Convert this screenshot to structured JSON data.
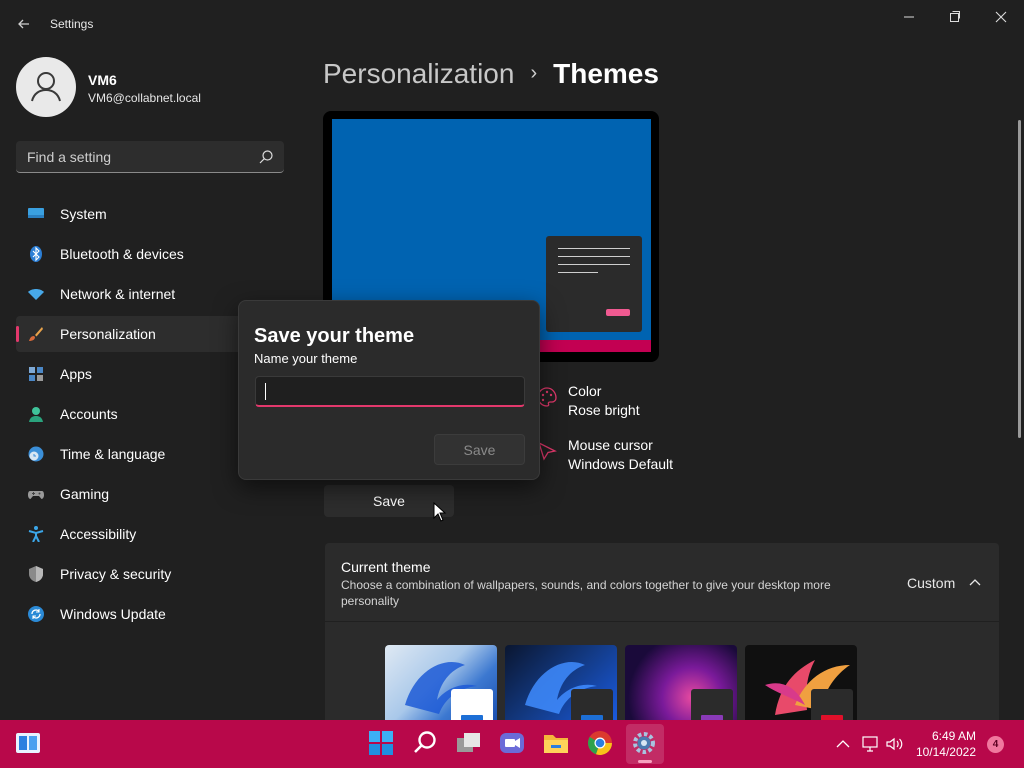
{
  "window": {
    "title": "Settings",
    "back_icon": "back-arrow-icon",
    "controls": [
      "minimize-icon",
      "restore-icon",
      "close-icon"
    ]
  },
  "user": {
    "name": "VM6",
    "email": "VM6@collabnet.local"
  },
  "search": {
    "placeholder": "Find a setting",
    "icon": "search-icon"
  },
  "nav": {
    "items": [
      {
        "label": "System",
        "icon": "system-icon"
      },
      {
        "label": "Bluetooth & devices",
        "icon": "bluetooth-icon"
      },
      {
        "label": "Network & internet",
        "icon": "wifi-icon"
      },
      {
        "label": "Personalization",
        "icon": "brush-icon",
        "active": true
      },
      {
        "label": "Apps",
        "icon": "apps-icon"
      },
      {
        "label": "Accounts",
        "icon": "person-icon"
      },
      {
        "label": "Time & language",
        "icon": "clock-globe-icon"
      },
      {
        "label": "Gaming",
        "icon": "gamepad-icon"
      },
      {
        "label": "Accessibility",
        "icon": "accessibility-icon"
      },
      {
        "label": "Privacy & security",
        "icon": "shield-icon"
      },
      {
        "label": "Windows Update",
        "icon": "update-icon"
      }
    ]
  },
  "header": {
    "parent": "Personalization",
    "separator": "›",
    "current": "Themes"
  },
  "props": {
    "color": {
      "title": "Color",
      "value": "Rose bright"
    },
    "cursor": {
      "title": "Mouse cursor",
      "value": "Windows Default"
    }
  },
  "page": {
    "save_label": "Save"
  },
  "current_theme": {
    "title": "Current theme",
    "description": "Choose a combination of wallpapers, sounds, and colors together to give your desktop more personality",
    "value": "Custom"
  },
  "dialog": {
    "title": "Save your theme",
    "label": "Name your theme",
    "input_value": "",
    "save_label": "Save"
  },
  "taskbar": {
    "apps": [
      "widgets-icon",
      "start-icon",
      "search-icon",
      "task-view-icon",
      "chat-icon",
      "file-explorer-icon",
      "chrome-icon",
      "settings-icon"
    ],
    "tray": [
      "chevron-up-icon",
      "network-icon",
      "volume-icon"
    ],
    "time": "6:49 AM",
    "date": "10/14/2022",
    "notifications": "4"
  },
  "colors": {
    "accent": "#e3386c",
    "taskbar": "#b8084a",
    "background": "#202020",
    "card": "#2b2b2b"
  }
}
